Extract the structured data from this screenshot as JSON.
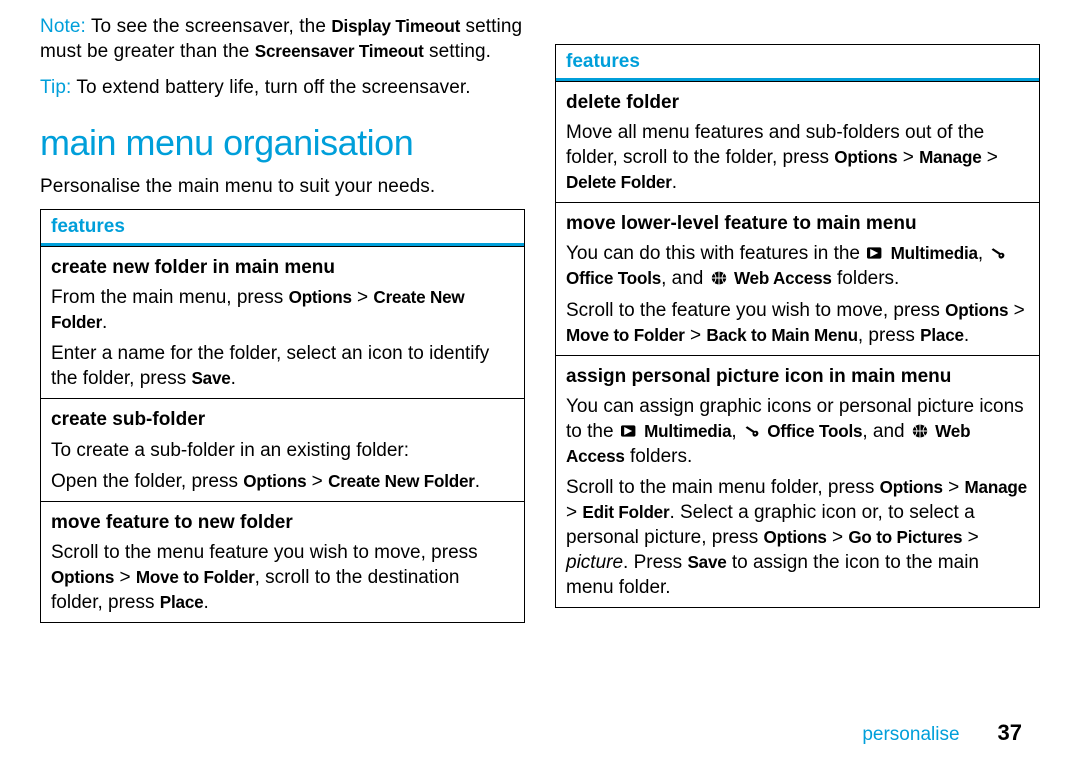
{
  "left": {
    "note_label": "Note:",
    "note_text1": " To see the screensaver, the ",
    "note_ui1": "Display Timeout",
    "note_text2": " setting must be greater than the ",
    "note_ui2": "Screensaver Timeout",
    "note_text3": " setting.",
    "tip_label": "Tip:",
    "tip_text": " To extend battery life, turn off the screensaver.",
    "heading": "main menu organisation",
    "intro": "Personalise the main menu to suit your needs.",
    "table_header": "features",
    "row1": {
      "name": "create new folder in main menu",
      "p1a": "From the main menu, press ",
      "p1b": "Options",
      "p1c": " > ",
      "p1d": "Create New Folder",
      "p1e": ".",
      "p2a": "Enter a name for the folder, select an icon to identify the folder, press ",
      "p2b": "Save",
      "p2c": "."
    },
    "row2": {
      "name": "create sub-folder",
      "p1": "To create a sub-folder in an existing folder:",
      "p2a": "Open the folder, press ",
      "p2b": "Options",
      "p2c": " > ",
      "p2d": "Create New Folder",
      "p2e": "."
    },
    "row3": {
      "name": "move feature to new folder",
      "p1a": "Scroll to the menu feature you wish to move, press ",
      "p1b": "Options",
      "p1c": " > ",
      "p1d": "Move to Folder",
      "p1e": ", scroll to the destination folder, press ",
      "p1f": "Place",
      "p1g": "."
    }
  },
  "right": {
    "table_header": "features",
    "row1": {
      "name": "delete folder",
      "p1a": "Move all menu features and sub-folders out of the folder, scroll to the folder, press ",
      "p1b": "Options",
      "p1c": " > ",
      "p1d": "Manage",
      "p1e": " > ",
      "p1f": "Delete Folder",
      "p1g": "."
    },
    "row2": {
      "name": "move lower-level feature to main menu",
      "p1a": "You can do this with features in the ",
      "i1": "Multimedia",
      "p1b": ", ",
      "i2": "Office Tools",
      "p1c": ", and ",
      "i3": "Web Access",
      "p1d": " folders.",
      "p2a": "Scroll to the feature you wish to move, press ",
      "p2b": "Options",
      "p2c": " > ",
      "p2d": "Move to Folder",
      "p2e": " > ",
      "p2f": "Back to Main Menu",
      "p2g": ", press ",
      "p2h": "Place",
      "p2i": "."
    },
    "row3": {
      "name": "assign personal picture icon in main menu",
      "p1a": "You can assign graphic icons or personal picture icons to the ",
      "i1": "Multimedia",
      "p1b": ", ",
      "i2": "Office Tools",
      "p1c": ", and ",
      "i3": "Web Access",
      "p1d": " folders.",
      "p2a": "Scroll to the main menu folder, press ",
      "p2b": "Options",
      "p2c": " > ",
      "p2d": "Manage",
      "p2e": " > ",
      "p2f": "Edit Folder",
      "p2g": ". Select a graphic icon or, to select a personal picture, press ",
      "p2h": "Options",
      "p2i": " > ",
      "p2j": "Go to Pictures",
      "p2k": " > ",
      "p2l": "picture",
      "p2m": ". Press ",
      "p2n": "Save",
      "p2o": " to assign the icon to the main menu folder."
    }
  },
  "footer": {
    "section": "personalise",
    "page": "37"
  }
}
